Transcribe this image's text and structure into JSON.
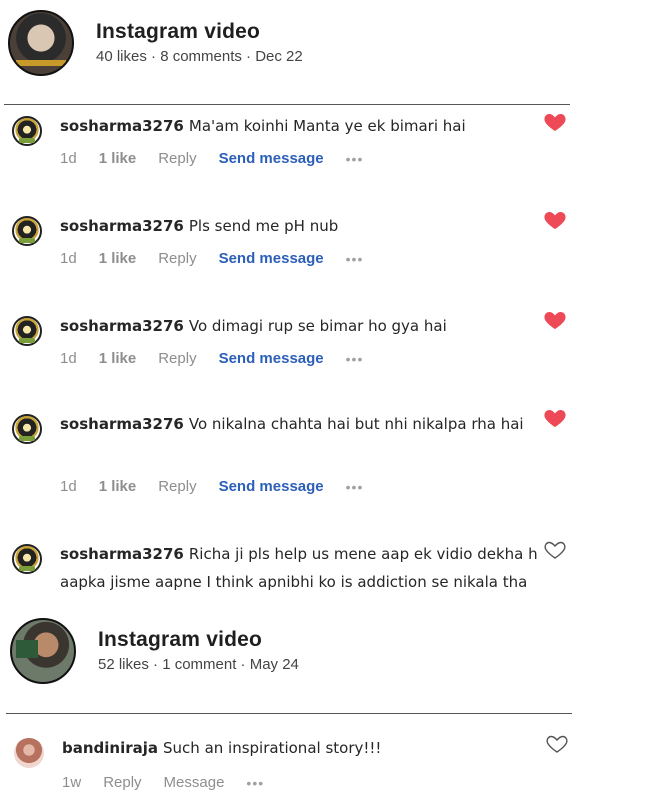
{
  "posts": [
    {
      "title": "Instagram video",
      "meta": "40 likes · 8 comments · Dec 22",
      "comments": [
        {
          "user": "sosharma3276",
          "text": "Ma'am koinhi Manta ye ek bimari hai",
          "time": "1d",
          "likes": "1 like",
          "reply": "Reply",
          "send": "Send message",
          "liked": true
        },
        {
          "user": "sosharma3276",
          "text": "Pls send me pH nub",
          "time": "1d",
          "likes": "1 like",
          "reply": "Reply",
          "send": "Send message",
          "liked": true
        },
        {
          "user": "sosharma3276",
          "text": "Vo dimagi rup se bimar ho gya hai",
          "time": "1d",
          "likes": "1 like",
          "reply": "Reply",
          "send": "Send message",
          "liked": true
        },
        {
          "user": "sosharma3276",
          "text": "Vo nikalna chahta hai but nhi nikalpa rha hai",
          "time": "1d",
          "likes": "1 like",
          "reply": "Reply",
          "send": "Send message",
          "liked": true
        },
        {
          "user": "sosharma3276",
          "text": "Richa ji pls help us mene aap ek vidio dekha h aapka jisme aapne I think apnibhi ko is addiction se nikala tha",
          "liked": false
        }
      ]
    },
    {
      "title": "Instagram video",
      "meta": "52 likes · 1 comment · May 24",
      "comments": [
        {
          "user": "bandiniraja",
          "text": "Such an inspirational story!!!",
          "time": "1w",
          "reply": "Reply",
          "send": "Message",
          "liked": false
        }
      ]
    }
  ],
  "icons": {
    "liked": "heart-filled-icon",
    "unliked": "heart-outline-icon",
    "more": "more-dots-icon"
  },
  "colors": {
    "heart": "#ed4956",
    "send": "#2c5fb8",
    "muted": "#8e8e8e"
  }
}
